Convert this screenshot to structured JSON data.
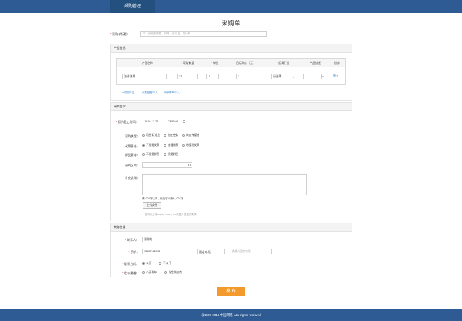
{
  "nav": {
    "tab_label": "采购管理"
  },
  "page_title": "采购单",
  "purchase_title": {
    "label": "采购单标题：",
    "placeholder": "如：采购圆珠笔、文件、办公桌、办公椅"
  },
  "product_info": {
    "header": "产品信息",
    "columns": [
      "产品名称",
      "采购数量",
      "单位",
      "目标单价（元）",
      "所属行业",
      "产品描述",
      "操作"
    ],
    "row": {
      "name": "演讲演讲",
      "quantity": "22",
      "unit": "2",
      "price": "2",
      "industry": "请选择",
      "description": "",
      "action": "删行"
    },
    "links": [
      "+添加产品",
      "采购批量导入",
      "从采购单导入"
    ]
  },
  "requirements": {
    "header": "采购要求",
    "deadline": {
      "label": "报价截止时间：",
      "date": "2016-12-22",
      "time": "23:59:59"
    },
    "type": {
      "label": "采购类型：",
      "options": [
        "现货/标准品",
        "加工定制",
        "供应商报错"
      ]
    },
    "invoice": {
      "label": "发票要求：",
      "options": [
        "不需要发票",
        "普通发票",
        "增值税发票"
      ]
    },
    "sample": {
      "label": "样品要求：",
      "options": [
        "不需要样品",
        "需要样品"
      ]
    },
    "region": {
      "label": "采购区域：",
      "value": ""
    },
    "notes": {
      "label": "补充说明：",
      "counter": "请1024字以内，你还可以输入1024字",
      "upload_label": "上传文件",
      "upload_hint": "您可以上传word、excel、txt或图片类型的文件"
    }
  },
  "other_info": {
    "header": "其他信息",
    "contact": {
      "label": "联系人：",
      "value": "测测的"
    },
    "phone": {
      "label": "手机：",
      "value": "15657182193",
      "landline_label": "固定电话：",
      "landline_value": "",
      "landline_placeholder": "请输入固定电话"
    },
    "contact_method": {
      "label": "联系方式：",
      "options": [
        "公开",
        "不公开"
      ]
    },
    "publish_channel": {
      "label": "发布渠道：",
      "options": [
        "公开发布",
        "指定供应商"
      ]
    }
  },
  "submit_label": "发 布",
  "footer_text": "@1999-2016 中国网络 ALL rights reserved"
}
